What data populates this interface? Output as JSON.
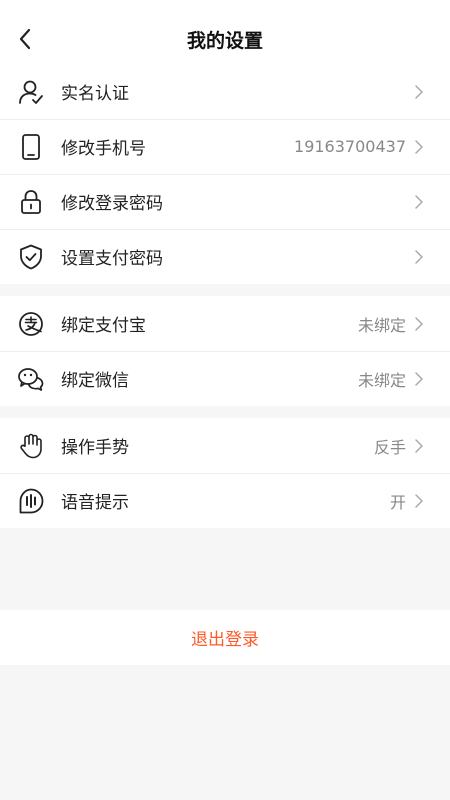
{
  "header": {
    "title": "我的设置",
    "back_icon": "chevron-left-icon"
  },
  "groups": [
    {
      "items": [
        {
          "label": "实名认证",
          "value": "",
          "icon": "user-verified-icon"
        },
        {
          "label": "修改手机号",
          "value": "19163700437",
          "icon": "phone-icon"
        },
        {
          "label": "修改登录密码",
          "value": "",
          "icon": "lock-icon"
        },
        {
          "label": "设置支付密码",
          "value": "",
          "icon": "shield-check-icon"
        }
      ]
    },
    {
      "items": [
        {
          "label": "绑定支付宝",
          "value": "未绑定",
          "icon": "alipay-icon"
        },
        {
          "label": "绑定微信",
          "value": "未绑定",
          "icon": "wechat-icon"
        }
      ]
    },
    {
      "items": [
        {
          "label": "操作手势",
          "value": "反手",
          "icon": "hand-icon"
        },
        {
          "label": "语音提示",
          "value": "开",
          "icon": "voice-icon"
        }
      ]
    }
  ],
  "logout": {
    "label": "退出登录",
    "color": "#ff5a2a"
  },
  "colors": {
    "background": "#f6f6f6",
    "text": "#222222",
    "muted": "#888888"
  }
}
